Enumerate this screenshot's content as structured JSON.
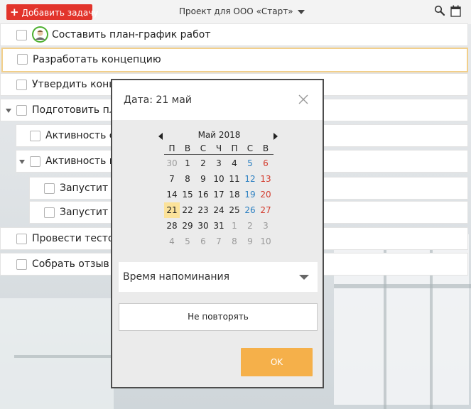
{
  "toolbar": {
    "add_task_label": "Добавить задачу",
    "project_label": "Проект для ООО «Старт»",
    "icons": [
      "search-icon",
      "calendar-icon"
    ]
  },
  "tasks": [
    {
      "label": "Составить план-график работ",
      "has_avatar": true
    },
    {
      "label": "Разработать концепцию",
      "selected": true
    },
    {
      "label": "Утвердить конц"
    },
    {
      "label": "Подготовить пл",
      "expanded": true
    },
    {
      "label": "Активность с",
      "level": 1
    },
    {
      "label": "Активность в",
      "level": 1,
      "expanded": true
    },
    {
      "label": "Запустит",
      "level": 2
    },
    {
      "label": "Запустит",
      "level": 2
    },
    {
      "label": "Провести тесто"
    },
    {
      "label": "Собрать отзыв"
    }
  ],
  "dialog": {
    "title": "Дата: 21 май",
    "calendar": {
      "month_label": "Май 2018",
      "weekdays": [
        "П",
        "В",
        "С",
        "Ч",
        "П",
        "С",
        "В"
      ],
      "weeks": [
        [
          "30",
          "1",
          "2",
          "3",
          "4",
          "5",
          "6"
        ],
        [
          "7",
          "8",
          "9",
          "10",
          "11",
          "12",
          "13"
        ],
        [
          "14",
          "15",
          "16",
          "17",
          "18",
          "19",
          "20"
        ],
        [
          "21",
          "22",
          "23",
          "24",
          "25",
          "26",
          "27"
        ],
        [
          "28",
          "29",
          "30",
          "31",
          "1",
          "2",
          "3"
        ],
        [
          "4",
          "5",
          "6",
          "7",
          "8",
          "9",
          "10"
        ]
      ],
      "selected_day": "21"
    },
    "reminder_label": "Время напоминания",
    "repeat_label": "Не повторять",
    "ok_label": "OK"
  },
  "colors": {
    "add_button": "#e2342b",
    "selected_border": "#f2cf8a",
    "today_bg": "#fbe29a",
    "saturday": "#2a7fc1",
    "sunday": "#d33a2c",
    "ok_button": "#f5b04a"
  }
}
